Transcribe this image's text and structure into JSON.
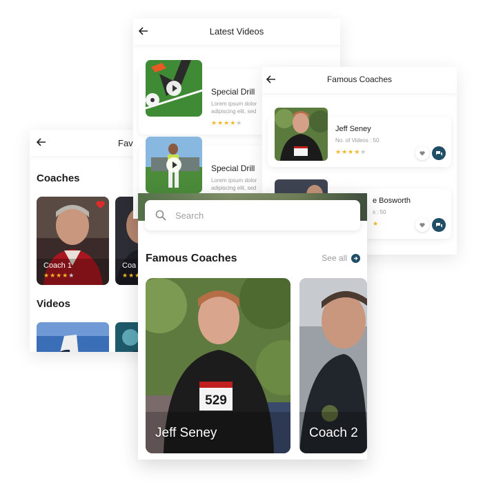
{
  "favourites_screen": {
    "title": "Favo",
    "coaches_heading": "Coaches",
    "videos_heading": "Videos",
    "coach_cards": [
      {
        "name": "Coach 1",
        "rating": 4,
        "favourited": true
      },
      {
        "name": "Coa",
        "rating": 4,
        "favourited": false
      }
    ]
  },
  "latest_videos_screen": {
    "title": "Latest Videos",
    "videos": [
      {
        "title": "Special Drill",
        "description_line1": "Lorem ipsum dolor",
        "description_line2": "adipiscing elit, sed",
        "rating": 4
      },
      {
        "title": "Special Drill",
        "description_line1": "Lorem ipsum dolor",
        "description_line2": "adipiscing elit, sed",
        "rating": 4
      }
    ]
  },
  "coach_list_screen": {
    "title": "Famous Coaches",
    "coaches": [
      {
        "name": "Jeff Seney",
        "videos": "No. of Videos : 50",
        "rating": 4
      },
      {
        "name": "e Bosworth",
        "videos": "s : 50",
        "rating": 4
      }
    ]
  },
  "home_screen": {
    "search": {
      "placeholder": "Search"
    },
    "section_title": "Famous Coaches",
    "see_all": "See all",
    "coach_cards": [
      {
        "name": "Jeff Seney",
        "bib_number": "529"
      },
      {
        "name": "Coach 2"
      }
    ]
  },
  "colors": {
    "accent": "#1f4e66",
    "star": "#f2b824",
    "heart": "#e02b2b"
  },
  "icons": [
    "back-arrow-icon",
    "heart-icon",
    "play-icon",
    "chat-icon",
    "search-icon",
    "arrow-right-icon",
    "star-icon"
  ]
}
